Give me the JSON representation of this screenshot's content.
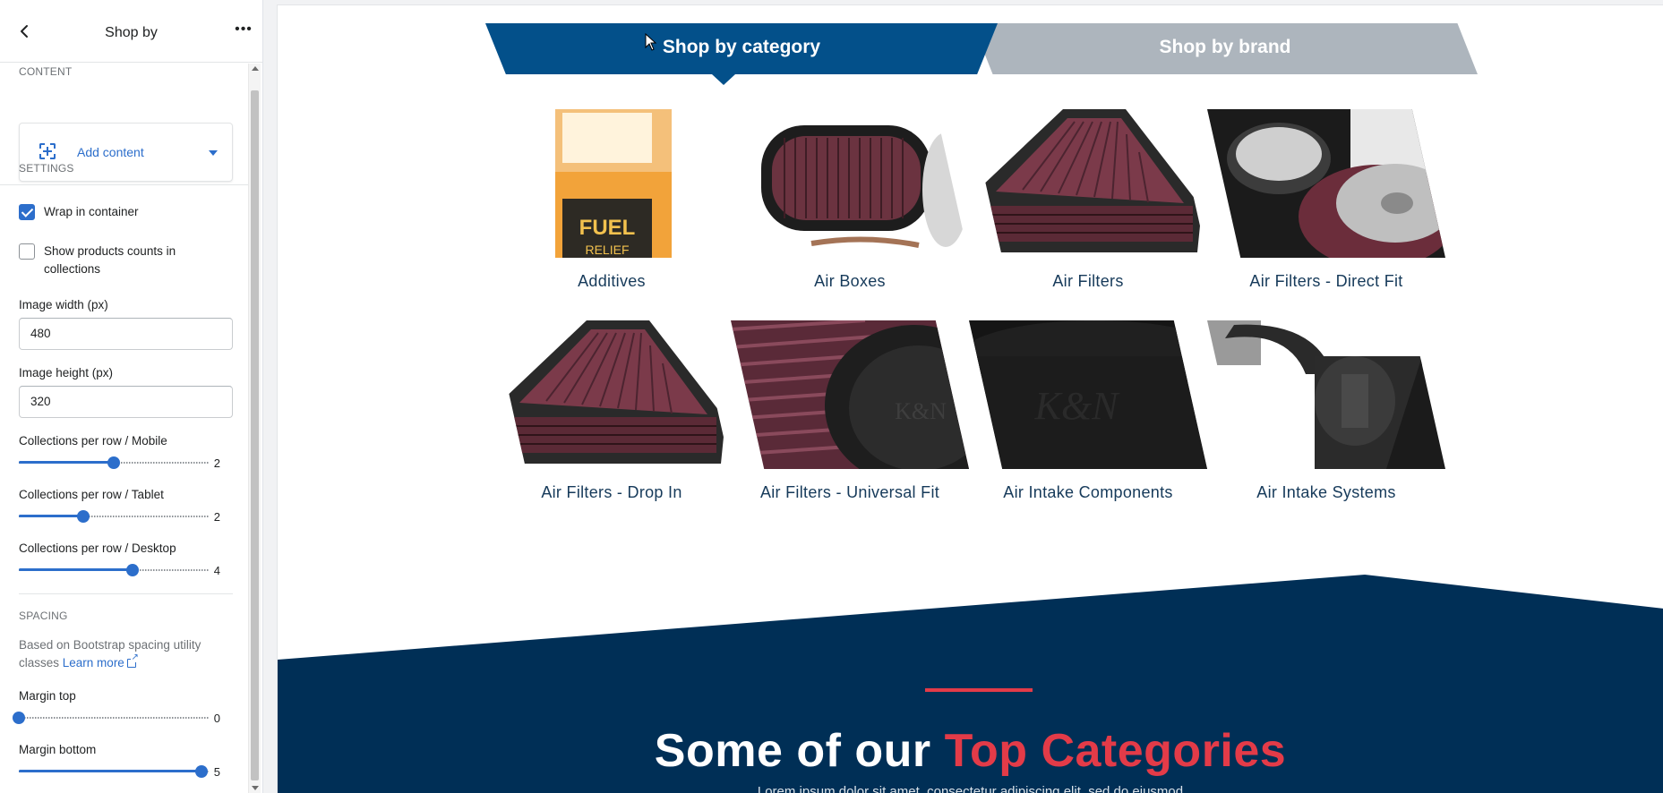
{
  "panel": {
    "title": "Shop by",
    "more_label": "•••",
    "content_section": "CONTENT",
    "add_content": "Add content",
    "settings_section": "SETTINGS",
    "wrap_label": "Wrap in container",
    "wrap_checked": true,
    "counts_label": "Show products counts in collections",
    "counts_checked": false,
    "image_width_label": "Image width (px)",
    "image_width_value": "480",
    "image_height_label": "Image height (px)",
    "image_height_value": "320",
    "sliders": [
      {
        "label": "Collections per row / Mobile",
        "value": "2",
        "fraction": 0.5
      },
      {
        "label": "Collections per row / Tablet",
        "value": "2",
        "fraction": 0.34
      },
      {
        "label": "Collections per row / Desktop",
        "value": "4",
        "fraction": 0.6
      }
    ],
    "spacing_section": "SPACING",
    "spacing_help": "Based on Bootstrap spacing utility classes",
    "learn_more": "Learn more",
    "margin_top_label": "Margin top",
    "margin_top_value": "0",
    "margin_top_fraction": 0.0,
    "margin_bottom_label": "Margin bottom",
    "margin_bottom_value": "5",
    "margin_bottom_fraction": 0.96
  },
  "preview": {
    "tab_category": "Shop by category",
    "tab_brand": "Shop by brand",
    "categories": [
      "Additives",
      "Air Boxes",
      "Air Filters",
      "Air Filters - Direct Fit",
      "Air Filters - Drop In",
      "Air Filters - Universal Fit",
      "Air Intake Components",
      "Air Intake Systems"
    ],
    "band_title_white": "Some of our ",
    "band_title_accent": "Top Categories",
    "band_sub": "Lorem ipsum dolor sit amet, consectetur adipiscing elit, sed do eiusmod"
  },
  "colors": {
    "tab_active": "#03508a",
    "tab_inactive": "#adb5bd",
    "band": "#002f56",
    "accent": "#e33b48",
    "link": "#2c6ecb"
  }
}
